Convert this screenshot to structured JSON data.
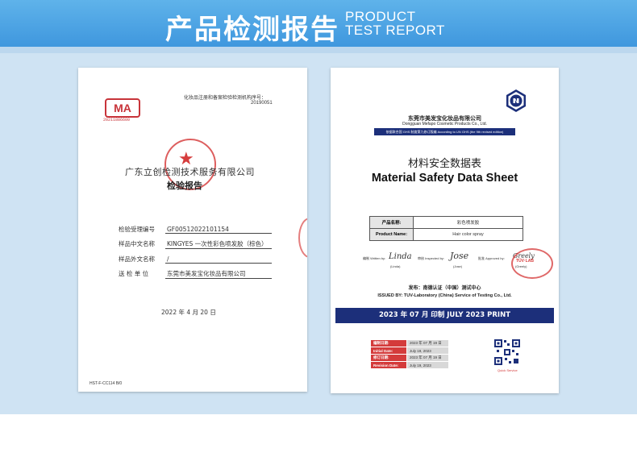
{
  "header": {
    "title_cn": "产品检测报告",
    "title_en_line1": "PRODUCT",
    "title_en_line2": "TEST REPORT"
  },
  "colors": {
    "banner": "#4aa3e4",
    "panel": "#cfe3f3",
    "navy": "#1c2f7a",
    "stamp_red": "#d22828"
  },
  "report1": {
    "ma_logo": "MA",
    "ma_number": "20211886600",
    "cert_line1": "化妆品注册和备案检验检测机构序号：",
    "cert_line2": "20190051",
    "org_name": "广东立创检测技术服务有限公司",
    "doc_title": "检验报告",
    "fields": [
      {
        "label": "检验受理编号",
        "value": "GF00512022101154"
      },
      {
        "label": "样品中文名称",
        "value": "KINGYES 一次性彩色喷发胶（棕色）"
      },
      {
        "label": "样品外文名称",
        "value": "/"
      },
      {
        "label": "送 检 单 位",
        "value": "东莞市美发宝化妆品有限公司"
      }
    ],
    "date": "2022 年 4 月 20 日",
    "form_code": "HST-F-CC114  B/0"
  },
  "report2": {
    "company_cn": "东莞市美发宝化妆品有限公司",
    "company_en": "Dongguan Mefapo Cosmetic Products Co., Ltd.",
    "ghs_note": "依据联合国 GHS 制度第九修订版编 According to UN GHS (the 9th revised edition)",
    "title_cn": "材料安全数据表",
    "title_en": "Material Safety Data Sheet",
    "product_table": [
      {
        "label": "产品名称:",
        "value": "彩色喷发胶"
      },
      {
        "label": "Product Name:",
        "value": "Hair color spray"
      }
    ],
    "written_by_label": "编制 Written by:",
    "written_by_sig": "Linda",
    "written_by_name": "(Linda)",
    "inspected_by_label": "审核 Inspected by:",
    "inspected_by_sig": "Jose",
    "inspected_by_name": "(Jose)",
    "approved_by_label": "批准 Approved by:",
    "approved_by_sig": "Greely",
    "approved_by_name": "(Greely)",
    "stamp_text": "TÜV·LAB",
    "publisher_cn": "发布：南德认证（中国）测试中心",
    "issued_by": "ISSUED BY:  TUV-Laboratory (China) Service of Testing Co., Ltd.",
    "print_bar": "2023 年 07 月  印制  JULY 2023 PRINT",
    "dates": [
      {
        "label": "编制日期:",
        "value": "2023 年 07 月 19 日"
      },
      {
        "label": "Initial Date:",
        "value": "July 19, 2023"
      },
      {
        "label": "修订日期:",
        "value": "2023 年 07 月 19 日"
      },
      {
        "label": "Revision Date:",
        "value": "July 19, 2023"
      }
    ],
    "qr_label": "Quick Service"
  }
}
